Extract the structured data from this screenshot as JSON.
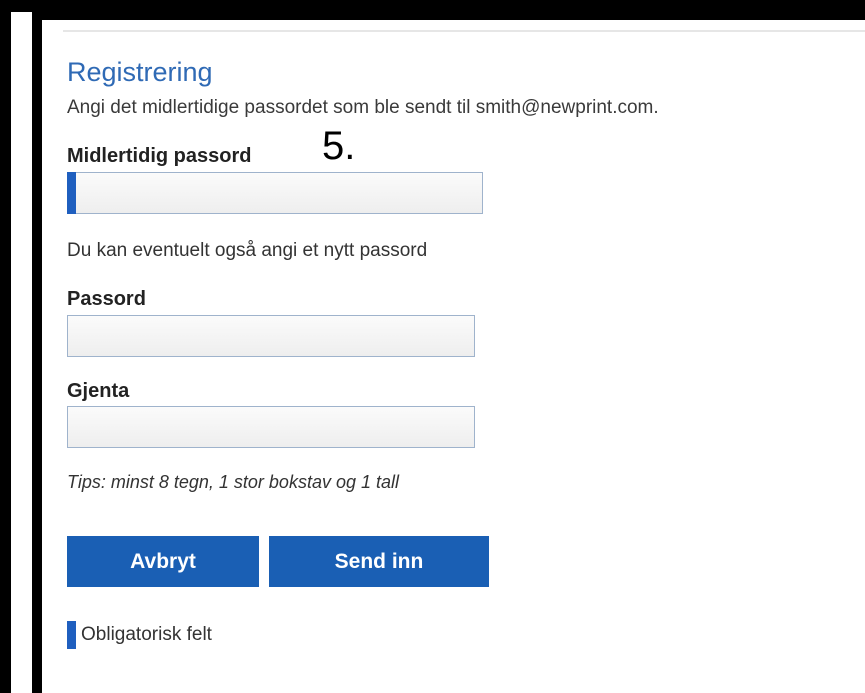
{
  "form": {
    "title": "Registrering",
    "description": "Angi det midlertidige passordet som ble sendt til smith@newprint.com.",
    "step_annotation": "5.",
    "temp_password_label": "Midlertidig passord",
    "temp_password_value": "",
    "optional_hint": "Du kan eventuelt også angi et nytt passord",
    "password_label": "Passord",
    "password_value": "",
    "repeat_label": "Gjenta",
    "repeat_value": "",
    "tips": "Tips: minst 8 tegn, 1 stor bokstav og 1 tall",
    "cancel_label": "Avbryt",
    "submit_label": "Send inn",
    "required_legend": "Obligatorisk felt"
  },
  "colors": {
    "accent": "#1a5fb4",
    "title": "#2f6ab5",
    "required_marker": "#1f5fbf"
  }
}
